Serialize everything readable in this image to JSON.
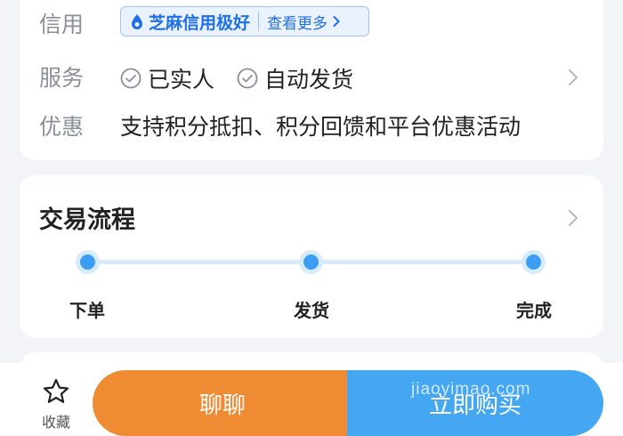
{
  "info": {
    "credit": {
      "label": "信用",
      "badge": "芝麻信用极好",
      "more": "查看更多"
    },
    "service": {
      "label": "服务",
      "items": [
        "已实人",
        "自动发货"
      ]
    },
    "discount": {
      "label": "优惠",
      "text": "支持积分抵扣、积分回馈和平台优惠活动"
    }
  },
  "flow": {
    "title": "交易流程",
    "steps": [
      "下单",
      "发货",
      "完成"
    ]
  },
  "bottom": {
    "favorite_label": "收藏",
    "chat_label": "聊聊",
    "buy_label": "立即购买"
  },
  "watermark": "jiaoyimao.com",
  "colors": {
    "accent_blue": "#45a6f2",
    "accent_orange": "#ef8c33",
    "credit_blue": "#1f6fe5",
    "step_dot": "#3c9ef3"
  }
}
